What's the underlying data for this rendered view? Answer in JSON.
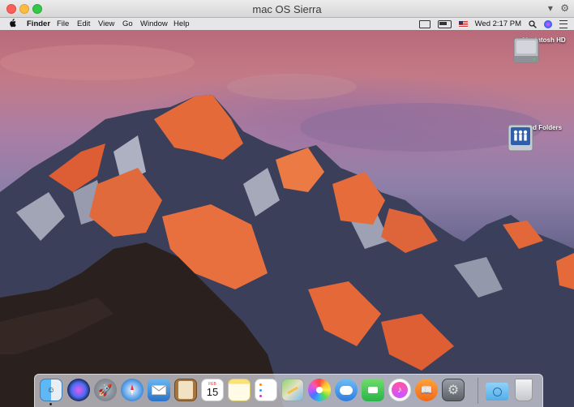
{
  "window": {
    "title": "mac OS Sierra"
  },
  "menubar": {
    "app_name": "Finder",
    "items": [
      "File",
      "Edit",
      "View",
      "Go",
      "Window",
      "Help"
    ],
    "clock": "Wed 2:17 PM"
  },
  "desktop": {
    "icons": [
      {
        "label": "Macintosh HD",
        "icon": "hard-drive-icon"
      },
      {
        "label": "Shared Folders",
        "icon": "shared-folders-icon"
      }
    ]
  },
  "dock": {
    "apps": [
      {
        "name": "Finder",
        "icon": "finder-icon",
        "running": true
      },
      {
        "name": "Siri",
        "icon": "siri-icon"
      },
      {
        "name": "Launchpad",
        "icon": "launchpad-icon"
      },
      {
        "name": "Safari",
        "icon": "safari-icon"
      },
      {
        "name": "Mail",
        "icon": "mail-icon"
      },
      {
        "name": "Contacts",
        "icon": "contacts-icon"
      },
      {
        "name": "Calendar",
        "icon": "calendar-icon",
        "month": "FEB",
        "day": "15"
      },
      {
        "name": "Notes",
        "icon": "notes-icon"
      },
      {
        "name": "Reminders",
        "icon": "reminders-icon"
      },
      {
        "name": "Maps",
        "icon": "maps-icon"
      },
      {
        "name": "Photos",
        "icon": "photos-icon"
      },
      {
        "name": "Messages",
        "icon": "messages-icon"
      },
      {
        "name": "FaceTime",
        "icon": "facetime-icon"
      },
      {
        "name": "iTunes",
        "icon": "itunes-icon"
      },
      {
        "name": "iBooks",
        "icon": "ibooks-icon"
      },
      {
        "name": "System Preferences",
        "icon": "system-preferences-icon"
      },
      {
        "name": "Downloads",
        "icon": "downloads-folder-icon"
      },
      {
        "name": "Trash",
        "icon": "trash-icon"
      }
    ]
  }
}
